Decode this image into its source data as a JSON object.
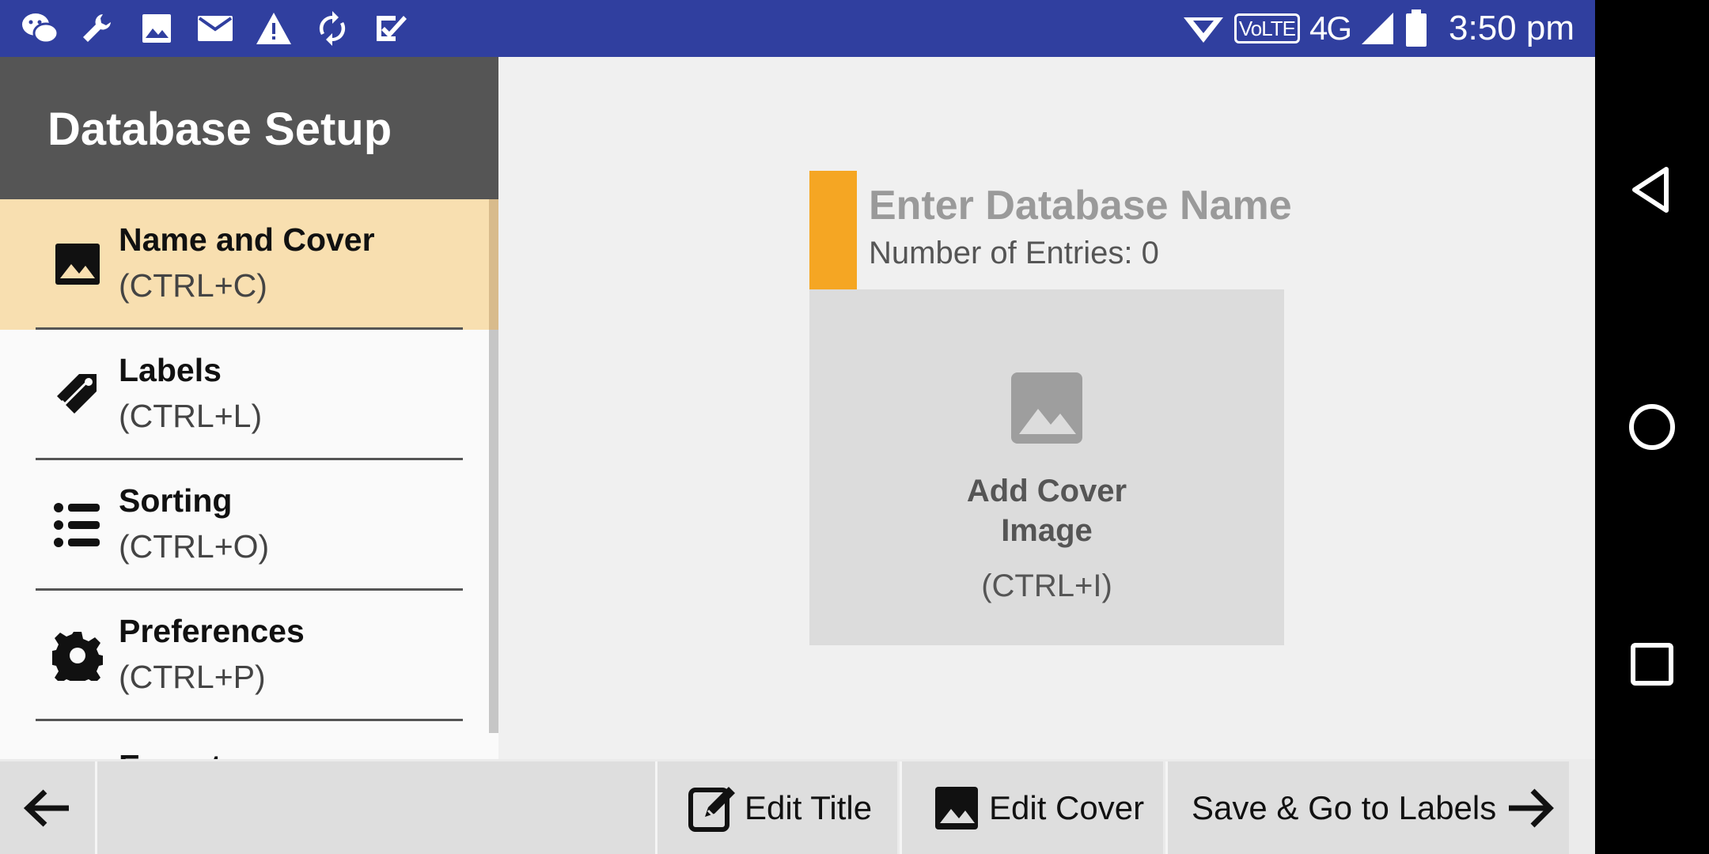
{
  "status_bar": {
    "left_icons": [
      "wechat-icon",
      "wrench-icon",
      "image-icon",
      "mail-icon",
      "warning-icon",
      "sync-icon",
      "checkbox-icon"
    ],
    "volte": "VoLTE",
    "network": "4G",
    "time": "3:50 pm"
  },
  "drawer": {
    "title": "Database Setup",
    "items": [
      {
        "label": "Name and Cover",
        "shortcut": "(CTRL+C)",
        "icon": "image-icon",
        "active": true
      },
      {
        "label": "Labels",
        "shortcut": "(CTRL+L)",
        "icon": "tag-icon"
      },
      {
        "label": "Sorting",
        "shortcut": "(CTRL+O)",
        "icon": "list-icon"
      },
      {
        "label": "Preferences",
        "shortcut": "(CTRL+P)",
        "icon": "gear-icon"
      },
      {
        "label": "Export",
        "shortcut": "",
        "icon": ""
      }
    ]
  },
  "main": {
    "db_name_placeholder": "Enter Database Name",
    "entries_text": "Number of Entries: 0",
    "cover_label": "Add Cover Image",
    "cover_shortcut": "(CTRL+I)"
  },
  "toolbar": {
    "edit_title": "Edit Title",
    "edit_cover": "Edit Cover",
    "save_go": "Save & Go to Labels"
  },
  "colors": {
    "status_bar": "#303f9f",
    "accent": "#f5a623",
    "active_item": "#f8dfb0",
    "drawer_header": "#555555"
  }
}
